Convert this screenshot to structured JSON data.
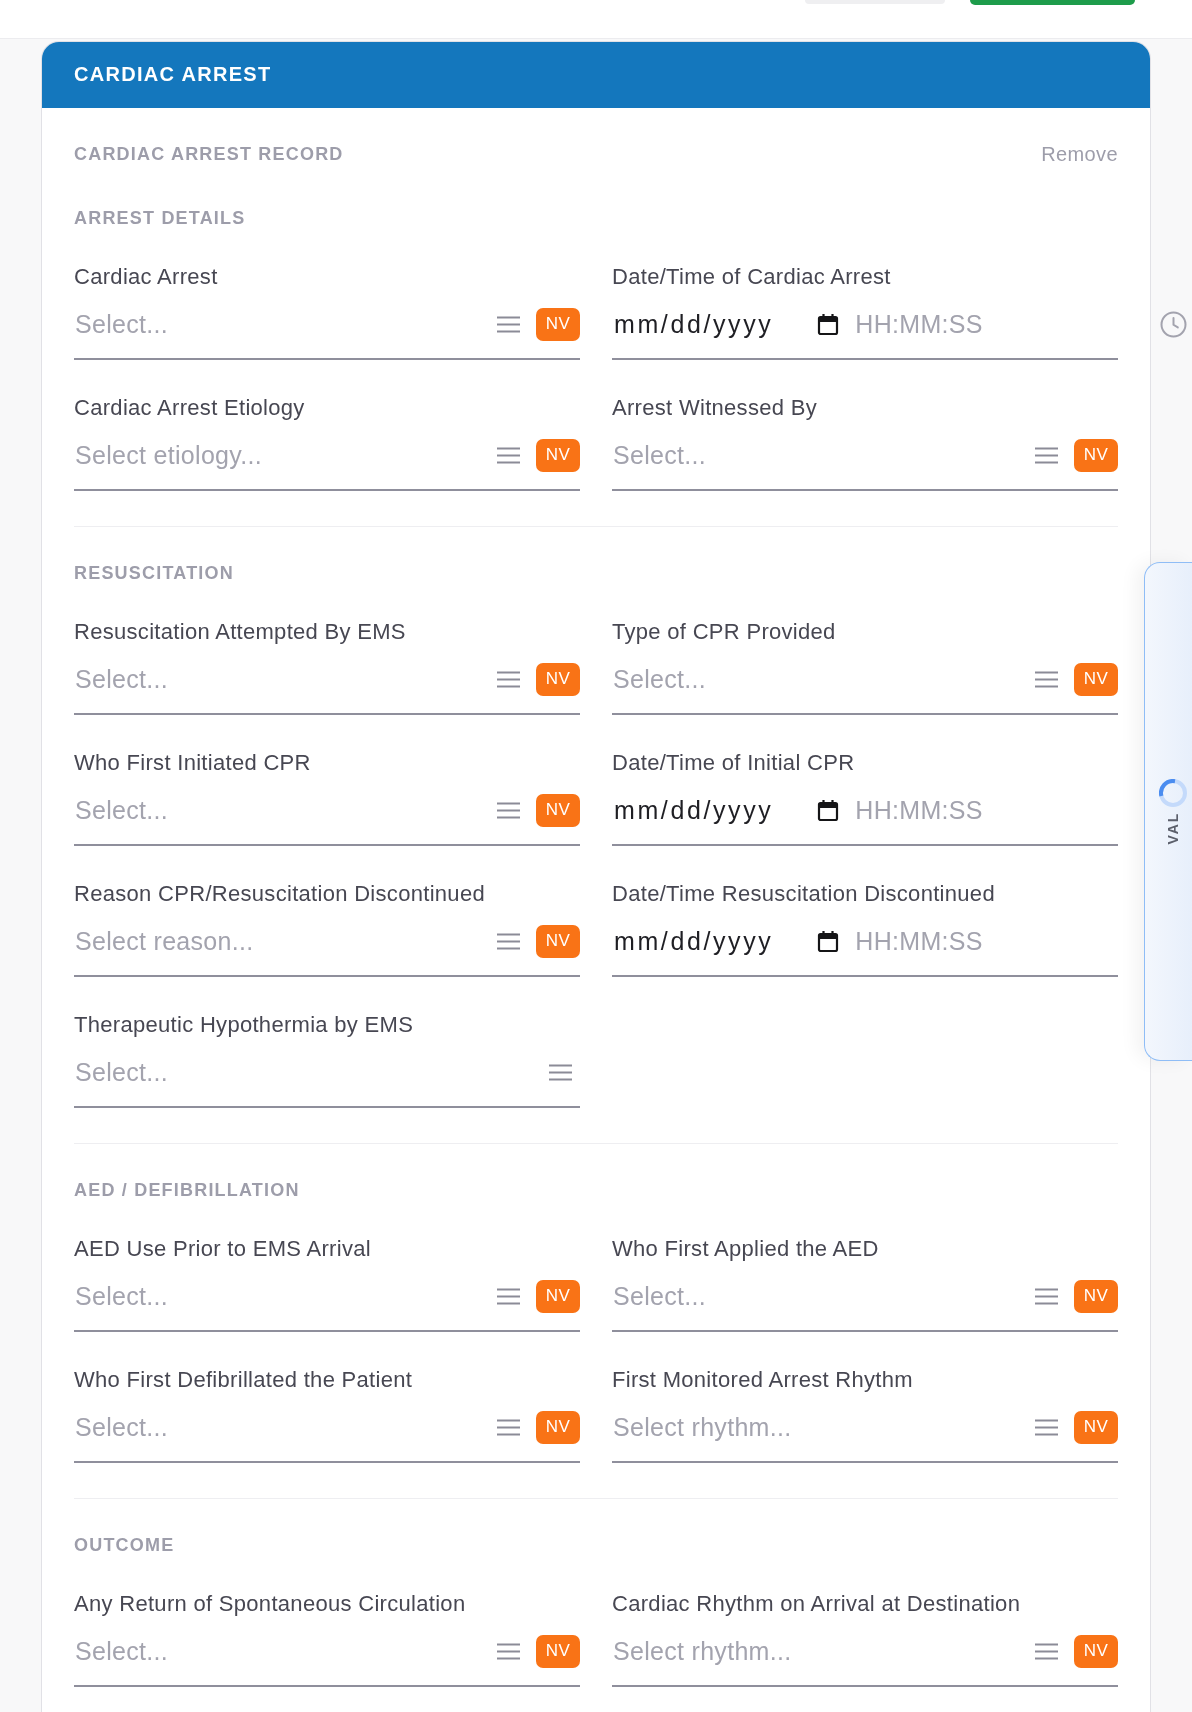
{
  "card": {
    "title": "CARDIAC ARREST"
  },
  "record": {
    "title": "CARDIAC ARREST RECORD",
    "action": "Remove"
  },
  "sections": [
    {
      "title": "ARREST DETAILS",
      "fields": [
        {
          "kind": "select",
          "label": "Cardiac Arrest",
          "placeholder": "Select...",
          "badge": "NV"
        },
        {
          "kind": "datetime",
          "label": "Date/Time of Cardiac Arrest",
          "date": "mm/dd/yyyy",
          "time_placeholder": "HH:MM:SS",
          "clock_icon": true
        },
        {
          "kind": "select",
          "label": "Cardiac Arrest Etiology",
          "placeholder": "Select etiology...",
          "badge": "NV"
        },
        {
          "kind": "select",
          "label": "Arrest Witnessed By",
          "placeholder": "Select...",
          "badge": "NV"
        }
      ]
    },
    {
      "title": "RESUSCITATION",
      "fields": [
        {
          "kind": "select",
          "label": "Resuscitation Attempted By EMS",
          "placeholder": "Select...",
          "badge": "NV"
        },
        {
          "kind": "select",
          "label": "Type of CPR Provided",
          "placeholder": "Select...",
          "badge": "NV"
        },
        {
          "kind": "select",
          "label": "Who First Initiated CPR",
          "placeholder": "Select...",
          "badge": "NV"
        },
        {
          "kind": "datetime",
          "label": "Date/Time of Initial CPR",
          "date": "mm/dd/yyyy",
          "time_placeholder": "HH:MM:SS"
        },
        {
          "kind": "select",
          "label": "Reason CPR/Resuscitation Discontinued",
          "placeholder": "Select reason...",
          "badge": "NV"
        },
        {
          "kind": "datetime",
          "label": "Date/Time Resuscitation Discontinued",
          "date": "mm/dd/yyyy",
          "time_placeholder": "HH:MM:SS"
        },
        {
          "kind": "select",
          "label": "Therapeutic Hypothermia by EMS",
          "placeholder": "Select..."
        }
      ]
    },
    {
      "title": "AED / DEFIBRILLATION",
      "fields": [
        {
          "kind": "select",
          "label": "AED Use Prior to EMS Arrival",
          "placeholder": "Select...",
          "badge": "NV"
        },
        {
          "kind": "select",
          "label": "Who First Applied the AED",
          "placeholder": "Select...",
          "badge": "NV"
        },
        {
          "kind": "select",
          "label": "Who First Defibrillated the Patient",
          "placeholder": "Select...",
          "badge": "NV"
        },
        {
          "kind": "select",
          "label": "First Monitored Arrest Rhythm",
          "placeholder": "Select rhythm...",
          "badge": "NV"
        }
      ]
    },
    {
      "title": "OUTCOME",
      "fields": [
        {
          "kind": "select",
          "label": "Any Return of Spontaneous Circulation",
          "placeholder": "Select...",
          "badge": "NV"
        },
        {
          "kind": "select",
          "label": "Cardiac Rhythm on Arrival at Destination",
          "placeholder": "Select rhythm...",
          "badge": "NV"
        }
      ]
    }
  ],
  "side_tab": {
    "label": "VAL"
  }
}
